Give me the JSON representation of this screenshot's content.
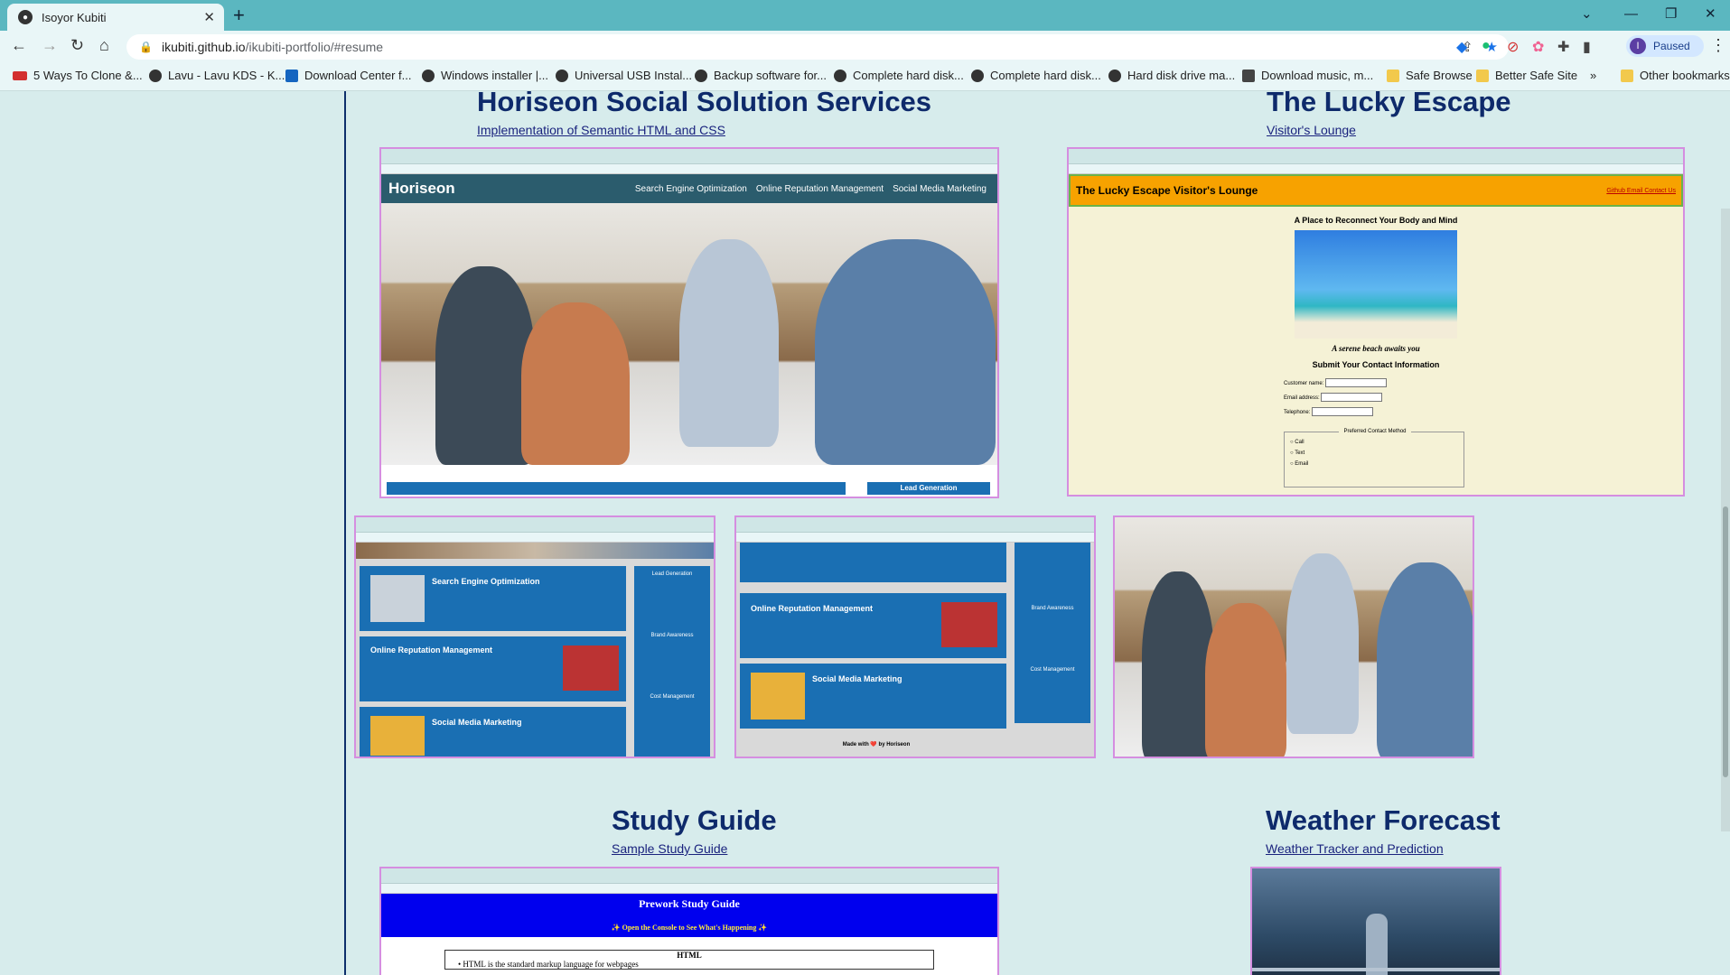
{
  "browser": {
    "tab_title": "Isoyor Kubiti",
    "tab_favicon": "github-icon",
    "url_host": "ikubiti.github.io",
    "url_path": "/ikubiti-portfolio/#resume",
    "profile_initial": "I",
    "profile_status": "Paused",
    "bookmarks": [
      "5 Ways To Clone &...",
      "Lavu - Lavu KDS - K...",
      "Download Center f...",
      "Windows installer |...",
      "Universal USB Instal...",
      "Backup software for...",
      "Complete hard disk...",
      "Complete hard disk...",
      "Hard disk drive ma...",
      "Download music, m...",
      "Safe Browse",
      "Better Safe Site"
    ],
    "bookmarks_overflow": "»",
    "other_bookmarks": "Other bookmarks"
  },
  "projects": {
    "horiseon": {
      "title": "Horiseon Social Solution Services",
      "link": "Implementation of Semantic HTML and CSS",
      "screenshot": {
        "logo": "Horiseon",
        "nav": [
          "Search Engine Optimization",
          "Online Reputation Management",
          "Social Media Marketing"
        ],
        "cta": "Lead Generation",
        "sections": [
          "Search Engine Optimization",
          "Online Reputation Management",
          "Social Media Marketing"
        ],
        "sidebar": [
          "Lead Generation",
          "Brand Awareness",
          "Cost Management"
        ],
        "footer": "Made with ❤️ by Horiseon"
      }
    },
    "lucky": {
      "title": "The Lucky Escape",
      "link": "Visitor's Lounge",
      "screenshot": {
        "header": "The Lucky Escape Visitor's Lounge",
        "header_links": "Github Email Contact Us",
        "tagline": "A Place to Reconnect Your Body and Mind",
        "caption": "A serene beach awaits you",
        "form_title": "Submit Your Contact Information",
        "fields": [
          "Customer name:",
          "Email address:",
          "Telephone:"
        ],
        "fieldset": "Preferred Contact Method",
        "options": [
          "Call",
          "Text",
          "Email"
        ]
      }
    },
    "study": {
      "title": "Study Guide",
      "link": "Sample Study Guide",
      "screenshot": {
        "heading": "Prework Study Guide",
        "subheading": "✨ Open the Console to See What's Happening ✨",
        "box_title": "HTML",
        "bullet": "HTML is the standard markup language for webpages"
      }
    },
    "weather": {
      "title": "Weather Forecast",
      "link": "Weather Tracker and Prediction"
    }
  }
}
